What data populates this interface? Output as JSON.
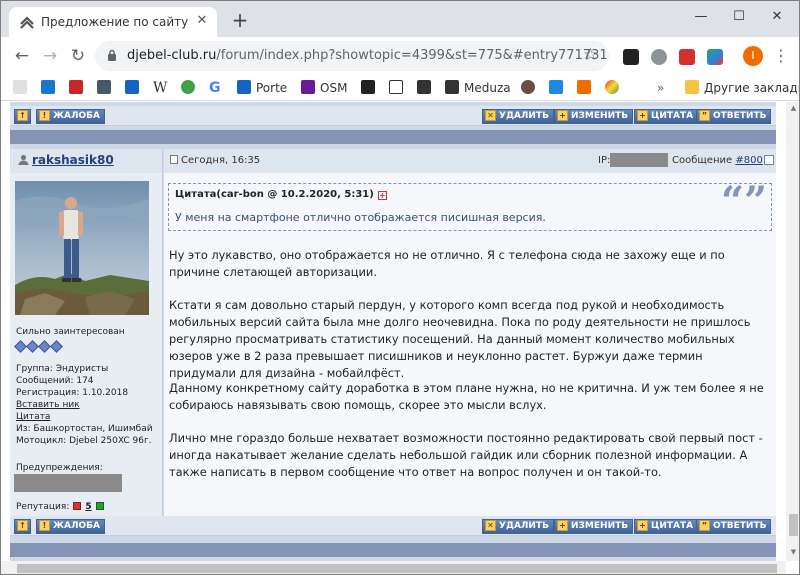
{
  "browser": {
    "tab_title": "Предложение по сайту - Форум",
    "tab_close": "✕",
    "new_tab": "+",
    "min": "—",
    "max": "☐",
    "close": "✕",
    "url_host": "djebel-club.ru",
    "url_path": "/forum/index.php?showtopic=4399&st=775&#entry771731",
    "profile_initial": "I",
    "bookmarks": [
      {
        "label": "Porte",
        "color": "#1565c0"
      },
      {
        "label": "OSM",
        "color": "#6a1b9a"
      },
      {
        "label": "Meduza",
        "color": "#333333"
      }
    ],
    "other_bookmarks": "Другие закладки"
  },
  "forum": {
    "complaint": "ЖАЛОБА",
    "delete": "УДАЛИТЬ",
    "edit": "ИЗМЕНИТЬ",
    "quote": "ЦИТАТА",
    "reply": "ОТВЕТИТЬ",
    "post": {
      "author": "rakshasik80",
      "date": "Сегодня, 16:35",
      "ip_label": "IP:",
      "msg_label": "Сообщение",
      "msg_number": "#800",
      "quote_header": "Цитата(car-bon @ 10.2.2020, 5:31)",
      "quote_text": "У меня на смартфоне отлично отображается писишная версия.",
      "paragraphs": [
        "Ну это лукавство, оно отображается но не отлично. Я с телефона сюда не захожу еще и по причине слетающей авторизации.",
        "Кстати я сам довольно старый пердун, у которого комп всегда под рукой и необходимость мобильных версий сайта была мне долго неочевидна. Пока по роду деятельности не пришлось регулярно просматривать статистику посещений. На данный момент количество мобильных юзеров уже в 2 раза превышает писишников и неуклонно растет. Буржуи даже термин придумали для дизайна - мобайлфёст.",
        "Данному конкретному сайту доработка в этом плане нужна, но не критична. И уж тем более я не собираюсь навязывать свою помощь, скорее это мысли вслух.",
        "Лично мне гораздо больше нехватает возможности постоянно редактировать свой первый пост - иногда накатывает желание сделать небольшой гайдик или сборник полезной информации. А также написать в первом сообщение что ответ на вопрос получен и он такой-то."
      ]
    },
    "user": {
      "rank": "Сильно заинтересован",
      "group": "Группа: Эндуристы",
      "posts": "Сообщений: 174",
      "registered": "Регистрация: 1.10.2018",
      "insert_nick": "Вставить ник",
      "quote_link": "Цитата",
      "from": "Из: Башкортостан, Ишимбай",
      "bike": "Мотоцикл: Djebel 250XC 96г.",
      "warnings": "Предупреждения:",
      "reputation_label": "Репутация:",
      "reputation_value": "5"
    }
  }
}
